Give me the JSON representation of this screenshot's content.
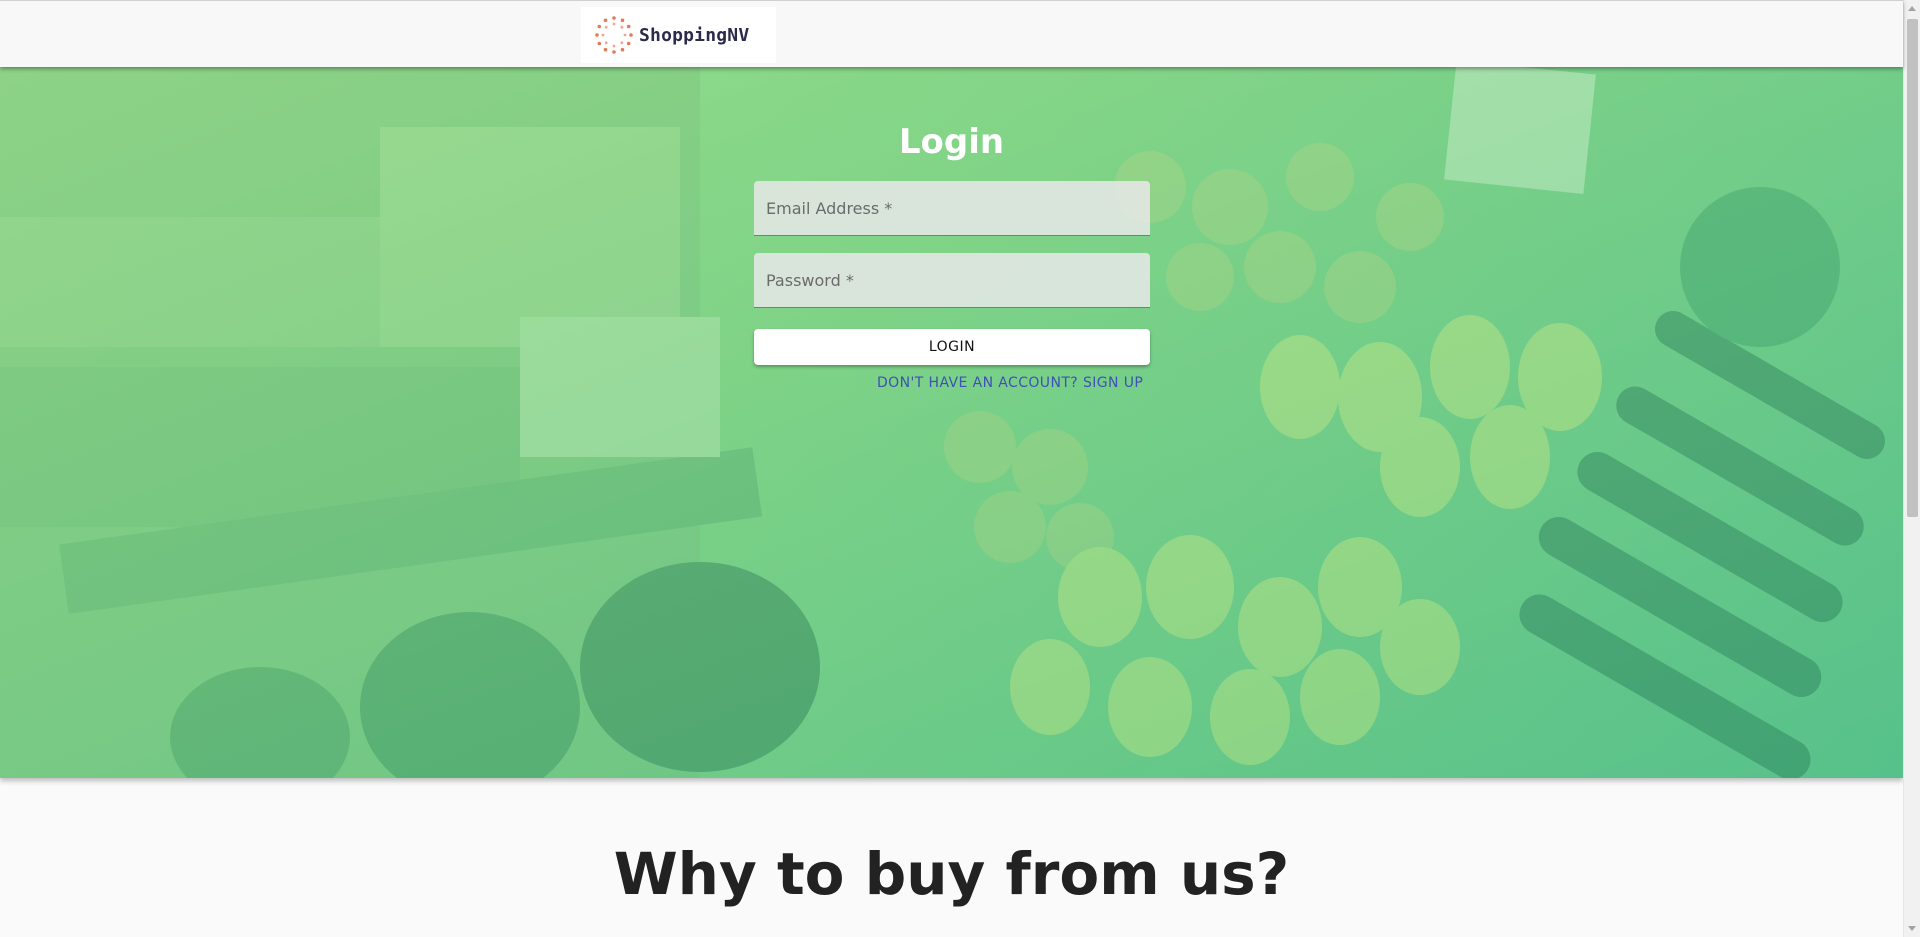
{
  "header": {
    "brand_name": "ShoppingNV",
    "logo_icon": "dotted-circle-logo"
  },
  "login": {
    "title": "Login",
    "email_placeholder": "Email Address *",
    "email_value": "",
    "password_placeholder": "Password *",
    "password_value": "",
    "login_button_label": "LOGIN",
    "signup_link_label": "DON'T HAVE AN ACCOUNT? SIGN UP"
  },
  "hero": {
    "overlay_color": "#7fd37e",
    "link_color": "#3f51b5"
  },
  "section": {
    "heading": "Why to buy from us?"
  }
}
